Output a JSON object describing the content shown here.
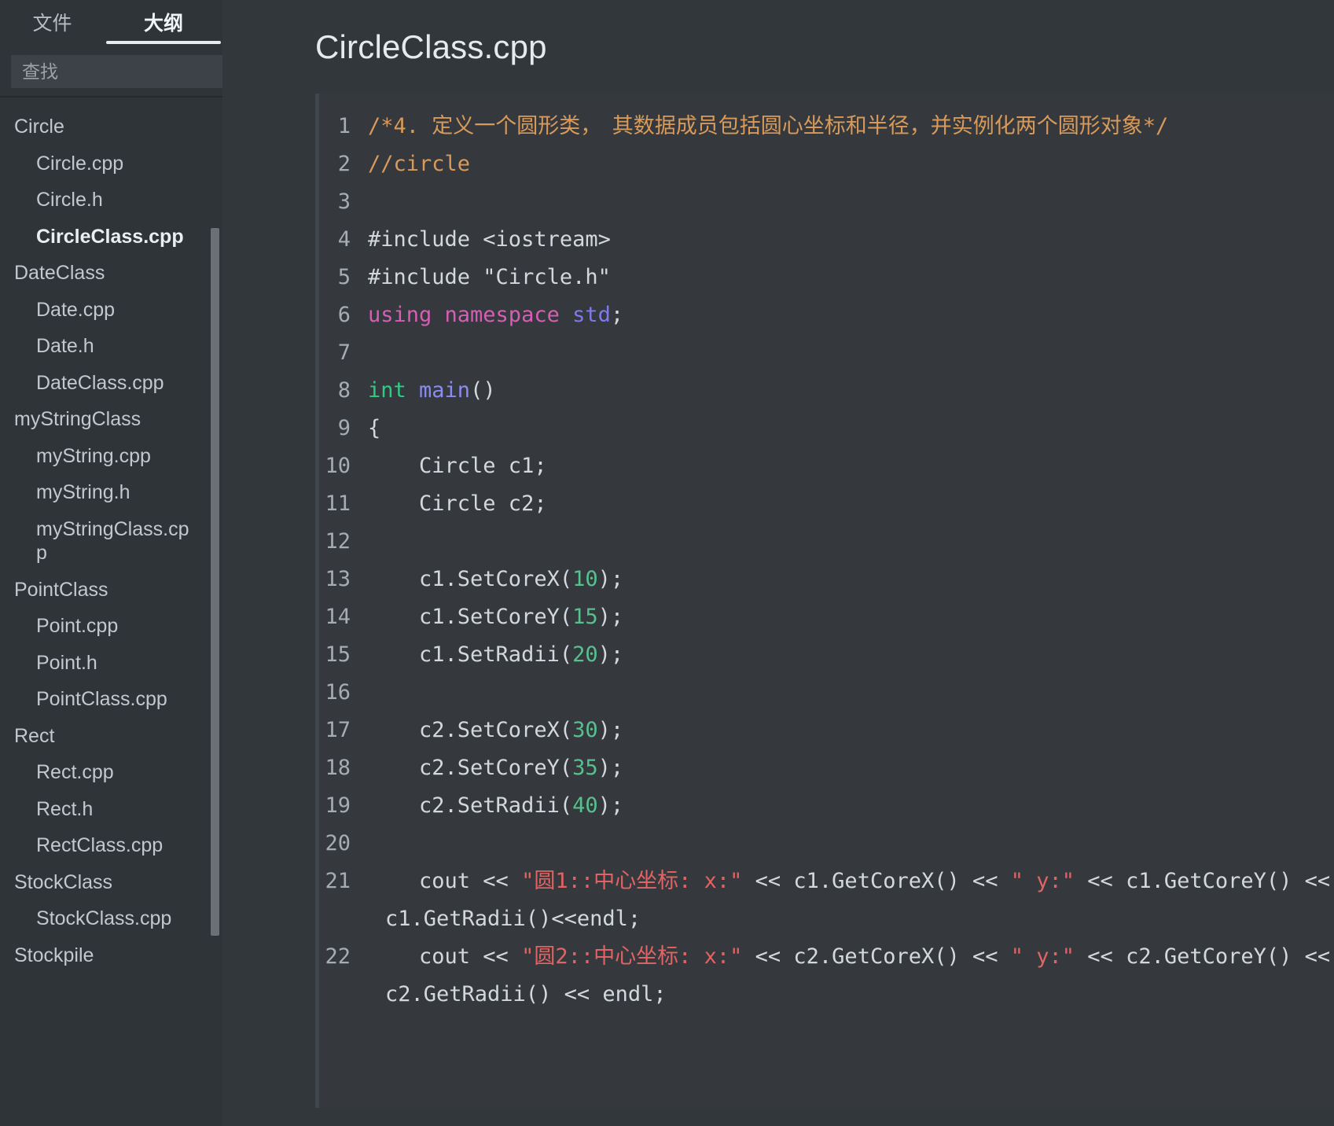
{
  "sidebar": {
    "tabs": [
      {
        "label": "文件",
        "name": "tab-files",
        "active": false
      },
      {
        "label": "大纲",
        "name": "tab-outline",
        "active": true
      }
    ],
    "search": {
      "placeholder": "查找",
      "value": "",
      "clear_glyph": "✕"
    },
    "tree": [
      {
        "label": "Circle",
        "level": 0,
        "active": false
      },
      {
        "label": "Circle.cpp",
        "level": 1,
        "active": false
      },
      {
        "label": "Circle.h",
        "level": 1,
        "active": false
      },
      {
        "label": "CircleClass.cpp",
        "level": 1,
        "active": true
      },
      {
        "label": "DateClass",
        "level": 0,
        "active": false
      },
      {
        "label": "Date.cpp",
        "level": 1,
        "active": false
      },
      {
        "label": "Date.h",
        "level": 1,
        "active": false
      },
      {
        "label": "DateClass.cpp",
        "level": 1,
        "active": false
      },
      {
        "label": "myStringClass",
        "level": 0,
        "active": false
      },
      {
        "label": "myString.cpp",
        "level": 1,
        "active": false
      },
      {
        "label": "myString.h",
        "level": 1,
        "active": false
      },
      {
        "label": "myStringClass.cpp",
        "level": 1,
        "active": false
      },
      {
        "label": "PointClass",
        "level": 0,
        "active": false
      },
      {
        "label": "Point.cpp",
        "level": 1,
        "active": false
      },
      {
        "label": "Point.h",
        "level": 1,
        "active": false
      },
      {
        "label": "PointClass.cpp",
        "level": 1,
        "active": false
      },
      {
        "label": "Rect",
        "level": 0,
        "active": false
      },
      {
        "label": "Rect.cpp",
        "level": 1,
        "active": false
      },
      {
        "label": "Rect.h",
        "level": 1,
        "active": false
      },
      {
        "label": "RectClass.cpp",
        "level": 1,
        "active": false
      },
      {
        "label": "StockClass",
        "level": 0,
        "active": false
      },
      {
        "label": "StockClass.cpp",
        "level": 1,
        "active": false
      },
      {
        "label": "Stockpile",
        "level": 0,
        "active": false
      }
    ]
  },
  "main": {
    "title": "CircleClass.cpp",
    "code": {
      "language": "cpp",
      "lines": [
        {
          "n": "1",
          "tokens": [
            {
              "t": "/*4. 定义一个圆形类，　其数据成员包括圆心坐标和半径，并实例化两个圆形对象*/",
              "c": "comment"
            }
          ]
        },
        {
          "n": "2",
          "tokens": [
            {
              "t": "//circle",
              "c": "comment"
            }
          ]
        },
        {
          "n": "3",
          "tokens": []
        },
        {
          "n": "4",
          "tokens": [
            {
              "t": "#include <iostream>",
              "c": "pre"
            }
          ]
        },
        {
          "n": "5",
          "tokens": [
            {
              "t": "#include \"Circle.h\"",
              "c": "pre"
            }
          ]
        },
        {
          "n": "6",
          "tokens": [
            {
              "t": "using namespace ",
              "c": "kw"
            },
            {
              "t": "std",
              "c": "ns"
            },
            {
              "t": ";",
              "c": "plain"
            }
          ]
        },
        {
          "n": "7",
          "tokens": []
        },
        {
          "n": "8",
          "tokens": [
            {
              "t": "int ",
              "c": "type"
            },
            {
              "t": "main",
              "c": "fn"
            },
            {
              "t": "()",
              "c": "plain"
            }
          ]
        },
        {
          "n": "9",
          "tokens": [
            {
              "t": "{",
              "c": "plain"
            }
          ]
        },
        {
          "n": "10",
          "tokens": [
            {
              "t": "    Circle c1;",
              "c": "plain"
            }
          ]
        },
        {
          "n": "11",
          "tokens": [
            {
              "t": "    Circle c2;",
              "c": "plain"
            }
          ]
        },
        {
          "n": "12",
          "tokens": []
        },
        {
          "n": "13",
          "tokens": [
            {
              "t": "    c1.SetCoreX(",
              "c": "plain"
            },
            {
              "t": "10",
              "c": "num"
            },
            {
              "t": ");",
              "c": "plain"
            }
          ]
        },
        {
          "n": "14",
          "tokens": [
            {
              "t": "    c1.SetCoreY(",
              "c": "plain"
            },
            {
              "t": "15",
              "c": "num"
            },
            {
              "t": ");",
              "c": "plain"
            }
          ]
        },
        {
          "n": "15",
          "tokens": [
            {
              "t": "    c1.SetRadii(",
              "c": "plain"
            },
            {
              "t": "20",
              "c": "num"
            },
            {
              "t": ");",
              "c": "plain"
            }
          ]
        },
        {
          "n": "16",
          "tokens": []
        },
        {
          "n": "17",
          "tokens": [
            {
              "t": "    c2.SetCoreX(",
              "c": "plain"
            },
            {
              "t": "30",
              "c": "num"
            },
            {
              "t": ");",
              "c": "plain"
            }
          ]
        },
        {
          "n": "18",
          "tokens": [
            {
              "t": "    c2.SetCoreY(",
              "c": "plain"
            },
            {
              "t": "35",
              "c": "num"
            },
            {
              "t": ");",
              "c": "plain"
            }
          ]
        },
        {
          "n": "19",
          "tokens": [
            {
              "t": "    c2.SetRadii(",
              "c": "plain"
            },
            {
              "t": "40",
              "c": "num"
            },
            {
              "t": ");",
              "c": "plain"
            }
          ]
        },
        {
          "n": "20",
          "tokens": []
        },
        {
          "n": "21",
          "tokens": [
            {
              "t": "    cout << ",
              "c": "plain"
            },
            {
              "t": "\"圆1::中心坐标: x:\"",
              "c": "str"
            },
            {
              "t": " << c1.GetCoreX() << ",
              "c": "plain"
            },
            {
              "t": "\" y:\"",
              "c": "str"
            },
            {
              "t": " << c1.GetCoreY() << ",
              "c": "plain"
            }
          ],
          "wrap": [
            {
              "t": "c1.GetRadii()<<endl;",
              "c": "plain"
            }
          ]
        },
        {
          "n": "22",
          "tokens": [
            {
              "t": "    cout << ",
              "c": "plain"
            },
            {
              "t": "\"圆2::中心坐标: x:\"",
              "c": "str"
            },
            {
              "t": " << c2.GetCoreX() << ",
              "c": "plain"
            },
            {
              "t": "\" y:\"",
              "c": "str"
            },
            {
              "t": " << c2.GetCoreY() << ",
              "c": "plain"
            }
          ],
          "wrap": [
            {
              "t": "c2.GetRadii() << endl;",
              "c": "plain"
            }
          ]
        }
      ]
    }
  },
  "colors": {
    "page_bg": "#32373b",
    "sidebar_bg": "#2f3438",
    "code_bg": "#35393d",
    "comment": "#d89a5a",
    "string": "#e06464",
    "number": "#56c18e",
    "keyword": "#d45fb4",
    "type": "#2ecb83",
    "function": "#8b8bf0",
    "namespace": "#7f79ee",
    "text": "#d3d8dd"
  }
}
